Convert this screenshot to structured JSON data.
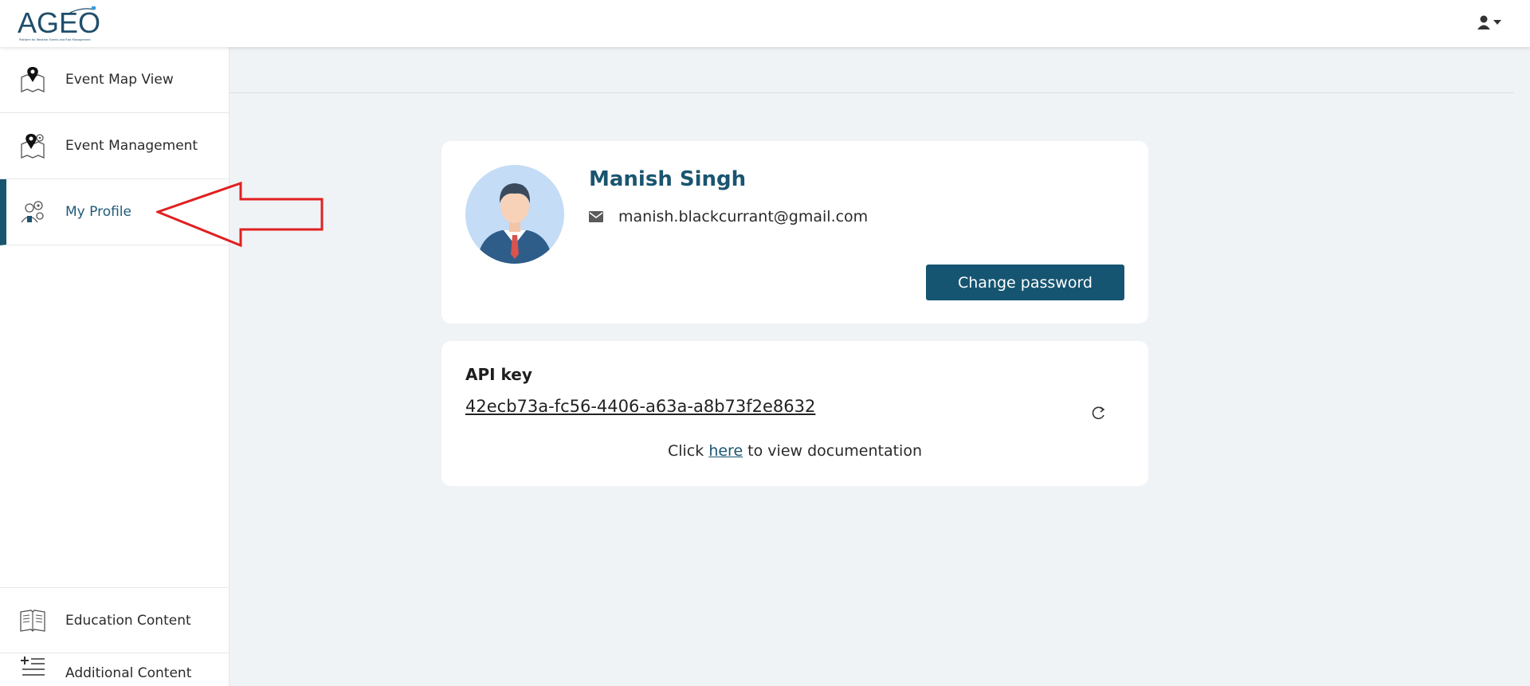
{
  "header": {
    "logo_text": "AGEO",
    "logo_subtitle": "Platform for Weather Events and Risk Management",
    "user_menu_icon": "user-dropdown-icon"
  },
  "sidebar": {
    "items": [
      {
        "label": "Event Map View",
        "icon": "map-pin-icon",
        "active": false
      },
      {
        "label": "Event Management",
        "icon": "map-gear-icon",
        "active": false
      },
      {
        "label": "My Profile",
        "icon": "profile-gear-icon",
        "active": true
      },
      {
        "label": "Education Content",
        "icon": "book-icon",
        "active": false
      },
      {
        "label": "Additional Content",
        "icon": "add-list-icon",
        "active": false
      }
    ]
  },
  "profile": {
    "name": "Manish Singh",
    "email": "manish.blackcurrant@gmail.com",
    "change_password_label": "Change password"
  },
  "api": {
    "title": "API key",
    "key": "42ecb73a-fc56-4406-a63a-a8b73f2e8632",
    "doc_prefix": "Click ",
    "doc_link": "here",
    "doc_suffix": " to view documentation"
  },
  "colors": {
    "primary": "#155571",
    "background": "#f0f3f6",
    "annotation_arrow": "#e02020"
  }
}
